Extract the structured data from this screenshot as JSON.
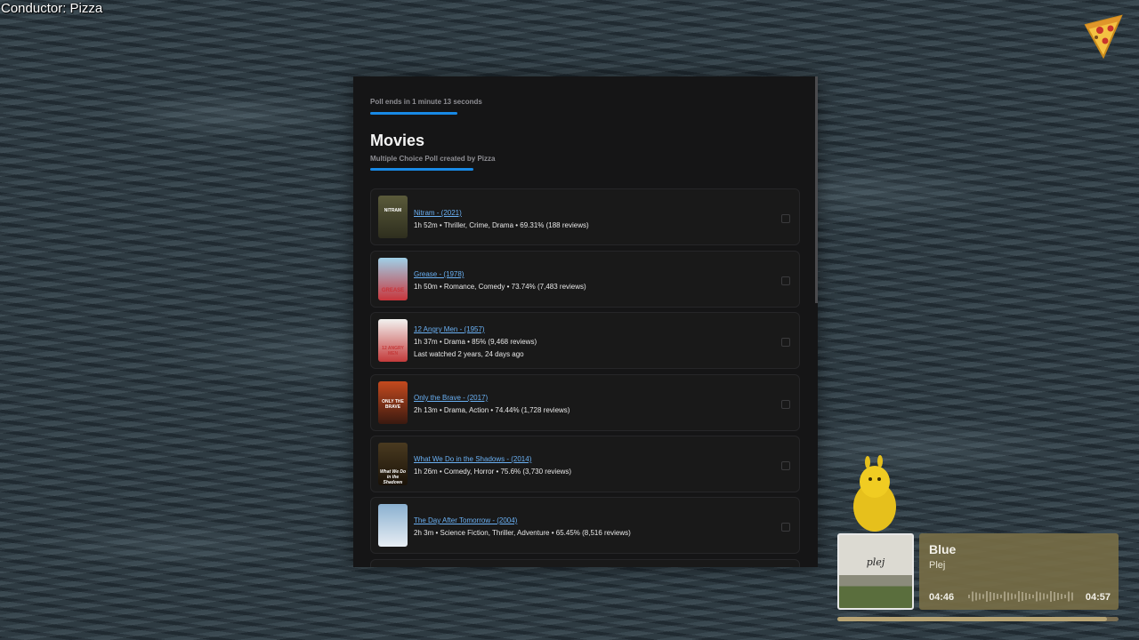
{
  "overlay": {
    "conductor_label": "Conductor: Pizza"
  },
  "poll": {
    "timer_text": "Poll ends in 1 minute 13 seconds",
    "title": "Movies",
    "subtitle": "Multiple Choice Poll created by Pizza",
    "items": [
      {
        "title": "Nitram - (2021)",
        "meta": "1h 52m • Thriller, Crime, Drama • 69.31% (188 reviews)",
        "extra": "",
        "poster_text": "NITRAM",
        "poster_colors": [
          "#5a5a3a",
          "#2e2e1e"
        ]
      },
      {
        "title": "Grease - (1978)",
        "meta": "1h 50m • Romance, Comedy • 73.74% (7,483 reviews)",
        "extra": "",
        "poster_text": "GREASE",
        "poster_colors": [
          "#9fd0e8",
          "#c8353b"
        ]
      },
      {
        "title": "12 Angry Men - (1957)",
        "meta": "1h 37m • Drama • 85% (9,468 reviews)",
        "extra": "Last watched 2 years, 24 days ago",
        "poster_text": "12 ANGRY MEN",
        "poster_colors": [
          "#f2f2f0",
          "#c43a3a"
        ]
      },
      {
        "title": "Only the Brave - (2017)",
        "meta": "2h 13m • Drama, Action • 74.44% (1,728 reviews)",
        "extra": "",
        "poster_text": "ONLY THE BRAVE",
        "poster_colors": [
          "#c44a1e",
          "#3a1a10"
        ]
      },
      {
        "title": "What We Do in the Shadows - (2014)",
        "meta": "1h 26m • Comedy, Horror • 75.6% (3,730 reviews)",
        "extra": "",
        "poster_text": "What We Do in the Shadows",
        "poster_colors": [
          "#4a3a20",
          "#1a1208"
        ]
      },
      {
        "title": "The Day After Tomorrow - (2004)",
        "meta": "2h 3m • Science Fiction, Thriller, Adventure • 65.45% (8,516 reviews)",
        "extra": "",
        "poster_text": "",
        "poster_colors": [
          "#8ab0d0",
          "#e8eef4"
        ]
      }
    ]
  },
  "player": {
    "song_title": "Blue",
    "artist": "Plej",
    "album_text": "plej",
    "elapsed": "04:46",
    "duration": "04:57",
    "progress_fraction": 0.96
  },
  "icons": [
    "pizza-icon",
    "mascot-figure"
  ],
  "colors": {
    "accent": "#1889e5",
    "link": "#6ab0f3",
    "player_bg": "#786e46"
  }
}
